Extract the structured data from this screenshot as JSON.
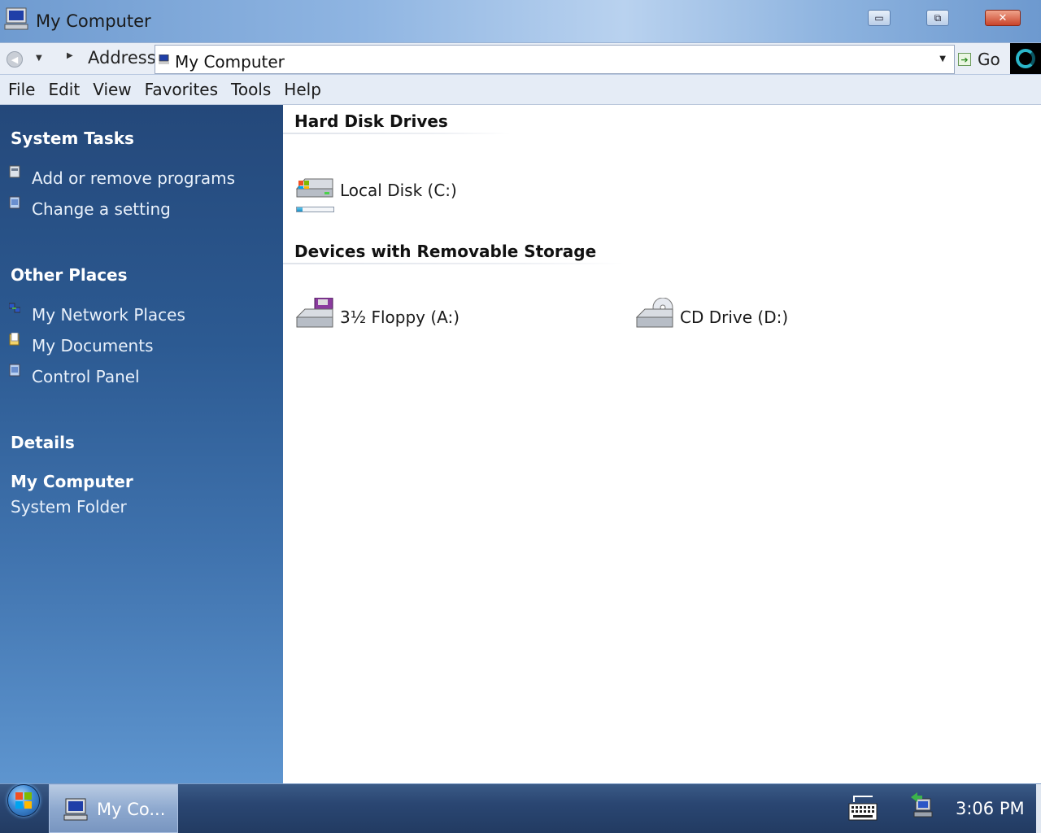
{
  "window": {
    "title": "My Computer",
    "controls": {
      "minimize": "▭",
      "restore": "⧉",
      "close": "✕"
    }
  },
  "addressbar": {
    "label": "Address",
    "value": "My Computer",
    "go_label": "Go"
  },
  "menubar": {
    "items": [
      "File",
      "Edit",
      "View",
      "Favorites",
      "Tools",
      "Help"
    ]
  },
  "sidebar": {
    "system_tasks": {
      "title": "System Tasks",
      "items": [
        "Add or remove programs",
        "Change a setting"
      ]
    },
    "other_places": {
      "title": "Other Places",
      "items": [
        "My Network Places",
        "My Documents",
        "Control Panel"
      ]
    },
    "details": {
      "title": "Details",
      "name": "My Computer",
      "type": "System Folder"
    }
  },
  "content": {
    "groups": [
      {
        "title": "Hard Disk Drives",
        "items": [
          {
            "label": "Local Disk (C:)",
            "icon": "hard-disk-icon",
            "usage_fraction": 0.15
          }
        ]
      },
      {
        "title": "Devices with Removable Storage",
        "items": [
          {
            "label": "3½ Floppy (A:)",
            "icon": "floppy-drive-icon"
          },
          {
            "label": "CD Drive (D:)",
            "icon": "cd-drive-icon"
          }
        ]
      }
    ]
  },
  "taskbar": {
    "task_label": "My Co...",
    "clock": "3:06 PM"
  },
  "colors": {
    "sidebar_top": "#24487a",
    "sidebar_bottom": "#5e95cf",
    "taskbar": "#223b62",
    "usage_fill": "#1c8ec4"
  }
}
